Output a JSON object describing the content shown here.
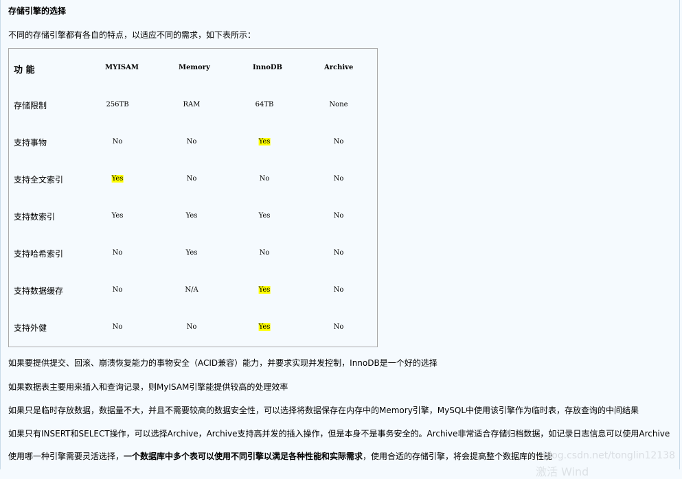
{
  "heading": "存储引擎的选择",
  "intro": "不同的存储引擎都有各自的特点，以适应不同的需求，如下表所示：",
  "table": {
    "headers": [
      "功 能",
      "MYISAM",
      "Memory",
      "InnoDB",
      "Archive"
    ],
    "rows": [
      {
        "label": "存储限制",
        "cells": [
          "256TB",
          "RAM",
          "64TB",
          "None"
        ],
        "highlight": [
          false,
          false,
          false,
          false
        ]
      },
      {
        "label": "支持事物",
        "cells": [
          "No",
          "No",
          "Yes",
          "No"
        ],
        "highlight": [
          false,
          false,
          true,
          false
        ]
      },
      {
        "label": "支持全文索引",
        "cells": [
          "Yes",
          "No",
          "No",
          "No"
        ],
        "highlight": [
          true,
          false,
          false,
          false
        ]
      },
      {
        "label": "支持数索引",
        "cells": [
          "Yes",
          "Yes",
          "Yes",
          "No"
        ],
        "highlight": [
          false,
          false,
          false,
          false
        ]
      },
      {
        "label": "支持哈希索引",
        "cells": [
          "No",
          "Yes",
          "No",
          "No"
        ],
        "highlight": [
          false,
          false,
          false,
          false
        ]
      },
      {
        "label": "支持数据缓存",
        "cells": [
          "No",
          "N/A",
          "Yes",
          "No"
        ],
        "highlight": [
          false,
          false,
          true,
          false
        ]
      },
      {
        "label": "支持外健",
        "cells": [
          "No",
          "No",
          "Yes",
          "No"
        ],
        "highlight": [
          false,
          false,
          true,
          false
        ]
      }
    ]
  },
  "paragraphs": {
    "p1": "如果要提供提交、回滚、崩溃恢复能力的事物安全（ACID兼容）能力，并要求实现并发控制，InnoDB是一个好的选择",
    "p2": "如果数据表主要用来插入和查询记录，则MyISAM引擎能提供较高的处理效率",
    "p3": "如果只是临时存放数据，数据量不大，并且不需要较高的数据安全性，可以选择将数据保存在内存中的Memory引擎，MySQL中使用该引擎作为临时表，存放查询的中间结果",
    "p4": "如果只有INSERT和SELECT操作，可以选择Archive，Archive支持高并发的插入操作，但是本身不是事务安全的。Archive非常适合存储归档数据，如记录日志信息可以使用Archive",
    "p5_a": "使用哪一种引擎需要灵活选择，",
    "p5_b": "一个数据库中多个表可以使用不同引擎以满足各种性能和实际需求",
    "p5_c": "，使用合适的存储引擎，将会提高整个数据库的性能"
  },
  "watermark": "blog.csdn.net/tonglin12138",
  "watermark_partial": "激活 Wind",
  "colors": {
    "highlight": "#ffff00",
    "background": "#f5fafe",
    "table_border": "#a9a9a9"
  }
}
